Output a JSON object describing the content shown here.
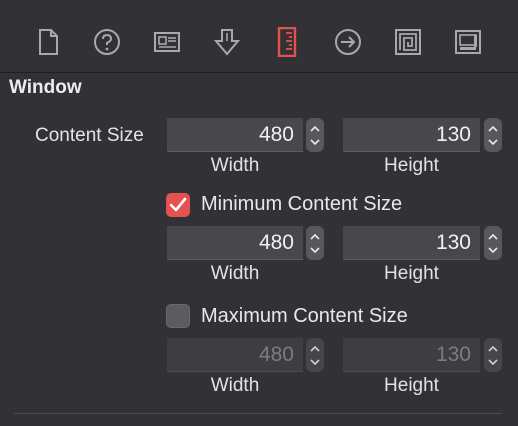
{
  "colors": {
    "background": "#323236",
    "accent": "#e5514f",
    "icon": "#a9a9ad"
  },
  "toolbar": {
    "icons": [
      "file-icon",
      "help-icon",
      "identity-icon",
      "attributes-icon",
      "size-icon",
      "connections-icon",
      "bindings-icon",
      "effects-icon"
    ],
    "selected": "size-icon"
  },
  "window": {
    "title": "Window",
    "content_size": {
      "label": "Content Size",
      "width": "480",
      "height": "130",
      "width_label": "Width",
      "height_label": "Height"
    },
    "minimum": {
      "label": "Minimum Content Size",
      "checked": true,
      "width": "480",
      "height": "130",
      "width_label": "Width",
      "height_label": "Height"
    },
    "maximum": {
      "label": "Maximum Content Size",
      "checked": false,
      "width": "480",
      "height": "130",
      "width_label": "Width",
      "height_label": "Height"
    }
  }
}
